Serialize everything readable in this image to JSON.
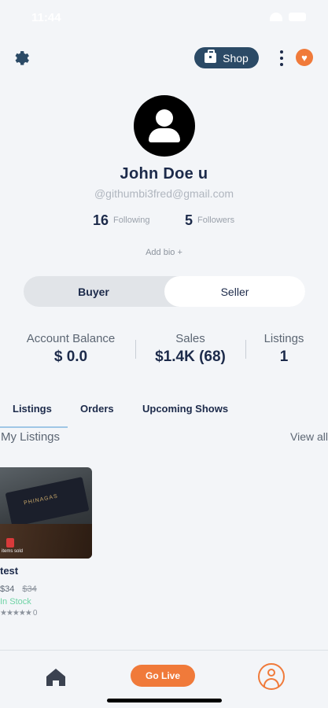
{
  "status_bar": {
    "time": "11:44"
  },
  "header": {
    "shop_label": "Shop"
  },
  "profile": {
    "name": "John Doe u",
    "email": "@githumbi3fred@gmail.com",
    "following_count": "16",
    "following_label": "Following",
    "followers_count": "5",
    "followers_label": "Followers",
    "add_bio": "Add bio +"
  },
  "mode_toggle": {
    "buyer": "Buyer",
    "seller": "Seller",
    "selected": "Seller"
  },
  "stats": [
    {
      "label": "Account Balance",
      "value": "$ 0.0"
    },
    {
      "label": "Sales",
      "value": "$1.4K (68)"
    },
    {
      "label": "Listings",
      "value": "1"
    }
  ],
  "tabs": [
    {
      "label": "Listings",
      "active": true
    },
    {
      "label": "Orders",
      "active": false
    },
    {
      "label": "Upcoming Shows",
      "active": false
    }
  ],
  "section": {
    "title": "My Listings",
    "view_all": "View all"
  },
  "listing": {
    "box_label": "PHINAGAS",
    "image_caption": "items sold",
    "title": "test",
    "price": "$34",
    "original_price": "$34",
    "stock": "In Stock",
    "stars": "★★★★★",
    "rating_count": "0"
  },
  "bottom_nav": {
    "go_live": "Go Live"
  },
  "colors": {
    "accent": "#f07a3a",
    "navy": "#1c2a4a",
    "shop_button": "#2b4a66",
    "stock_green": "#6fd3a5"
  }
}
